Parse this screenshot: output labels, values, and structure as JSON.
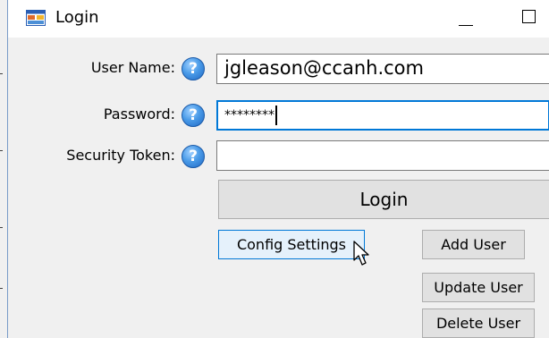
{
  "window": {
    "title": "Login",
    "icon": "form-app-icon",
    "controls": {
      "minimize": "minimize-icon",
      "maximize": "maximize-icon"
    }
  },
  "form": {
    "username": {
      "label": "User Name:",
      "value": "jgleason@ccanh.com"
    },
    "password": {
      "label": "Password:",
      "value": "********"
    },
    "security_token": {
      "label": "Security Token:",
      "value": ""
    },
    "help_glyph": "?"
  },
  "buttons": {
    "login": "Login",
    "config_settings": "Config Settings",
    "add_user": "Add User",
    "update_user": "Update User",
    "delete_user": "Delete User"
  },
  "colors": {
    "accent": "#0078d7",
    "button_face": "#e1e1e1",
    "client_background": "#f0f0f0",
    "help_icon": "#2d7fd6"
  }
}
